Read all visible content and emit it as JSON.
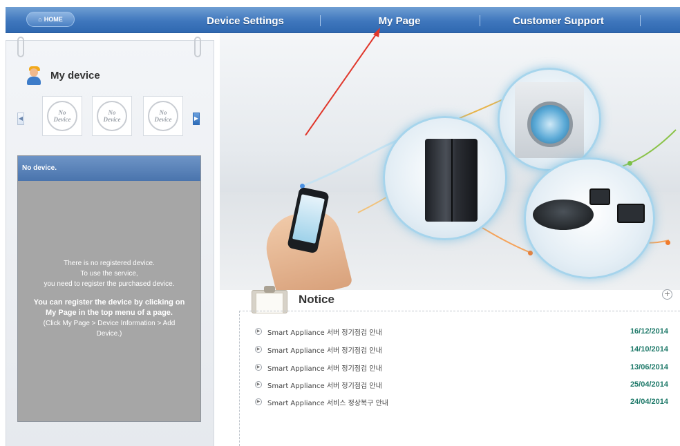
{
  "nav": {
    "home_label": "HOME",
    "items": [
      "Device Settings",
      "My Page",
      "Customer Support"
    ]
  },
  "sidebar": {
    "title": "My device",
    "devices": [
      {
        "line1": "No",
        "line2": "Device"
      },
      {
        "line1": "No",
        "line2": "Device"
      },
      {
        "line1": "No",
        "line2": "Device"
      }
    ],
    "status_header": "No device.",
    "message": {
      "line1": "There is no registered device.",
      "line2": "To use the service,",
      "line3": "you need to register the purchased device.",
      "bold1": "You can register the device by clicking on",
      "bold2": "My Page in the top menu of a page.",
      "hint1": "(Click My Page > Device Information > Add",
      "hint2": "Device.)"
    }
  },
  "notice": {
    "title": "Notice",
    "items": [
      {
        "title": "Smart Appliance 서버 정기점검 안내",
        "date": "16/12/2014"
      },
      {
        "title": "Smart Appliance 서버 정기점검 안내",
        "date": "14/10/2014"
      },
      {
        "title": "Smart Appliance 서버 정기점검 안내",
        "date": "13/06/2014"
      },
      {
        "title": "Smart Appliance 서버 정기점검 안내",
        "date": "25/04/2014"
      },
      {
        "title": "Smart Appliance 서비스 정상복구 안내",
        "date": "24/04/2014"
      }
    ]
  },
  "colors": {
    "nav_blue": "#3f77bd",
    "date_green": "#1f7a6a",
    "annotation_red": "#e0372b"
  }
}
